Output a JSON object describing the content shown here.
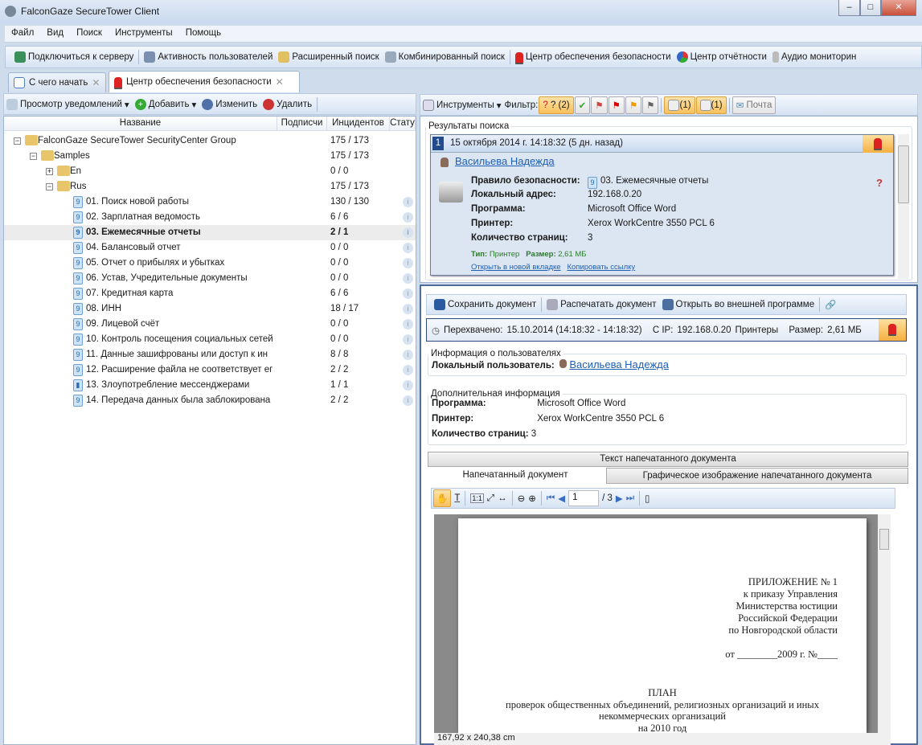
{
  "window": {
    "title": "FalconGaze SecureTower Client"
  },
  "menu": [
    "Файл",
    "Вид",
    "Поиск",
    "Инструменты",
    "Помощь"
  ],
  "toolbar": [
    "Подключиться к серверу",
    "Активность пользователей",
    "Расширенный поиск",
    "Комбинированный поиск",
    "Центр обеспечения безопасности",
    "Центр отчётности",
    "Аудио мониторин"
  ],
  "tabs": [
    {
      "label": "С чего начать"
    },
    {
      "label": "Центр обеспечения безопасности"
    }
  ],
  "left": {
    "toolbar": {
      "view": "Просмотр уведомлений",
      "add": "Добавить",
      "edit": "Изменить",
      "delete": "Удалить"
    },
    "columns": [
      "Название",
      "Подписчи",
      "Инцидентов",
      "Стату"
    ],
    "tree": [
      {
        "name": "FalconGaze SecureTower SecurityCenter Group",
        "count": "175 / 173",
        "level": 0,
        "type": "folder",
        "exp": "−"
      },
      {
        "name": "Samples",
        "count": "175 / 173",
        "level": 1,
        "type": "folder",
        "exp": "−"
      },
      {
        "name": "En",
        "count": "0 / 0",
        "level": 2,
        "type": "folder",
        "exp": "+"
      },
      {
        "name": "Rus",
        "count": "175 / 173",
        "level": 2,
        "type": "folder",
        "exp": "−"
      },
      {
        "name": "01. Поиск новой работы",
        "count": "130 / 130",
        "level": 3,
        "type": "rule"
      },
      {
        "name": "02. Зарплатная ведомость",
        "count": "6 / 6",
        "level": 3,
        "type": "rule"
      },
      {
        "name": "03. Ежемесячные отчеты",
        "count": "2 / 1",
        "level": 3,
        "type": "rule",
        "selected": true
      },
      {
        "name": "04. Балансовый отчет",
        "count": "0 / 0",
        "level": 3,
        "type": "rule"
      },
      {
        "name": "05. Отчет о прибылях и убытках",
        "count": "0 / 0",
        "level": 3,
        "type": "rule"
      },
      {
        "name": "06. Устав, Учредительные документы",
        "count": "0 / 0",
        "level": 3,
        "type": "rule"
      },
      {
        "name": "07. Кредитная карта",
        "count": "6 / 6",
        "level": 3,
        "type": "rule"
      },
      {
        "name": "08. ИНН",
        "count": "18 / 17",
        "level": 3,
        "type": "rule"
      },
      {
        "name": "09. Лицевой счёт",
        "count": "0 / 0",
        "level": 3,
        "type": "rule"
      },
      {
        "name": "10. Контроль посещения социальных сетей",
        "count": "0 / 0",
        "level": 3,
        "type": "rule"
      },
      {
        "name": "11. Данные зашифрованы или доступ к ин",
        "count": "8 / 8",
        "level": 3,
        "type": "rule"
      },
      {
        "name": "12. Расширение файла не соответствует ег",
        "count": "2 / 2",
        "level": 3,
        "type": "rule"
      },
      {
        "name": "13. Злоупотребление мессенджерами",
        "count": "1 / 1",
        "level": 3,
        "type": "stat"
      },
      {
        "name": "14. Передача данных была заблокирована",
        "count": "2 / 2",
        "level": 3,
        "type": "rule"
      }
    ]
  },
  "right": {
    "toolbar": {
      "tools": "Инструменты",
      "filter": "Фильтр:",
      "q": "? (2)",
      "f1": "(1)",
      "f2": "(1)",
      "mail": "Почта"
    },
    "results_label": "Результаты поиска",
    "result": {
      "num": "1",
      "date": "15 октября 2014 г. 14:18:32 (5 дн. назад)",
      "user": "Васильева Надежда",
      "fields": [
        [
          "Правило безопасности:",
          "03. Ежемесячные отчеты"
        ],
        [
          "Локальный адрес:",
          "192.168.0.20"
        ],
        [
          "Программа:",
          "Microsoft Office Word"
        ],
        [
          "Принтер:",
          "Xerox WorkCentre 3550 PCL 6"
        ],
        [
          "Количество страниц:",
          "3"
        ]
      ],
      "type_label": "Тип:",
      "type": "Принтер",
      "size_label": "Размер:",
      "size": "2,61 МБ",
      "open_link": "Открыть в новой вкладке",
      "copy_link": "Копировать ссылку"
    },
    "doc_toolbar": {
      "save": "Сохранить документ",
      "print": "Распечатать документ",
      "open": "Открыть во внешней программе"
    },
    "info_bar": {
      "intercepted": "Перехвачено:",
      "date": "15.10.2014 (14:18:32 - 14:18:32)",
      "ip_label": "С IP:",
      "ip": "192.168.0.20",
      "category": "Принтеры",
      "size_label": "Размер:",
      "size": "2,61 МБ"
    },
    "user_info": {
      "title": "Информация о пользователях",
      "label": "Локальный пользователь:",
      "user": "Васильева Надежда"
    },
    "extra": {
      "title": "Дополнительная информация",
      "fields": [
        [
          "Программа:",
          "Microsoft Office Word"
        ],
        [
          "Принтер:",
          "Xerox WorkCentre 3550 PCL 6"
        ],
        [
          "Количество страниц:",
          "3"
        ]
      ]
    },
    "text_tab": "Текст напечатанного документа",
    "subtabs": [
      "Напечатанный документ",
      "Графическое изображение напечатанного документа"
    ],
    "viewer": {
      "page": "1",
      "total": "/ 3",
      "status": "167,92 x 240,38 cm"
    },
    "document": {
      "right_lines": [
        "ПРИЛОЖЕНИЕ № 1",
        "к приказу Управления",
        "Министерства юстиции",
        "Российской Федерации",
        "по Новгородской области"
      ],
      "date_line": "от ________2009 г. №____",
      "center_lines": [
        "ПЛАН",
        "проверок общественных объединений, религиозных организаций и иных",
        "некоммерческих организаций",
        "на 2010 год"
      ]
    }
  }
}
